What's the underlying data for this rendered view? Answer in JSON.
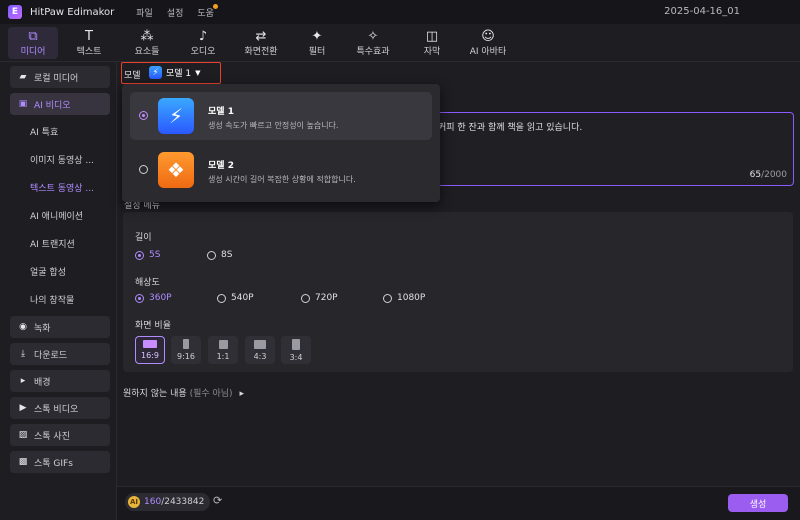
{
  "titlebar": {
    "app_name": "HitPaw Edimakor",
    "menus": [
      "파일",
      "설정",
      "도움"
    ],
    "project_name": "2025-04-16_01"
  },
  "tooltabs": [
    {
      "label": "미디어",
      "icon": "media-icon",
      "active": true
    },
    {
      "label": "텍스트",
      "icon": "text-icon"
    },
    {
      "label": "요소들",
      "icon": "elements-icon"
    },
    {
      "label": "오디오",
      "icon": "audio-icon"
    },
    {
      "label": "화면전환",
      "icon": "transition-icon"
    },
    {
      "label": "필터",
      "icon": "filter-icon"
    },
    {
      "label": "특수효과",
      "icon": "effects-icon"
    },
    {
      "label": "자막",
      "icon": "subtitle-icon"
    },
    {
      "label": "AI 아바타",
      "icon": "avatar-icon"
    }
  ],
  "sidebar": {
    "items": [
      {
        "label": "로컬 미디어"
      },
      {
        "label": "AI 비디오"
      },
      {
        "label": "AI 특효"
      },
      {
        "label": "이미지 동영상 ..."
      },
      {
        "label": "텍스트 동영상 ..."
      },
      {
        "label": "AI 애니메이션"
      },
      {
        "label": "AI 트랜지션"
      },
      {
        "label": "얼굴 합성"
      },
      {
        "label": "나의 창작물"
      },
      {
        "label": "녹화"
      },
      {
        "label": "다운로드"
      },
      {
        "label": "배경"
      },
      {
        "label": "스톡 비디오"
      },
      {
        "label": "스톡 사진"
      },
      {
        "label": "스톡 GIFs"
      }
    ]
  },
  "model_select": {
    "label": "모델",
    "value": "모델 1"
  },
  "model_dropdown": {
    "options": [
      {
        "name": "모델 1",
        "desc": "생성 속도가 빠르고 안정성이 높습니다.",
        "selected": true,
        "color": "#2f7bff"
      },
      {
        "name": "모델 2",
        "desc": "생성 시간이 길어 복잡한 상황에 적합합니다.",
        "selected": false,
        "color": "#f07a1a"
      }
    ]
  },
  "prompt": {
    "text": "커피 한 잔과 함께 책을 읽고 있습니다.",
    "count": "65",
    "max": "/2000"
  },
  "settings": {
    "title": "설정 메뉴",
    "length_label": "길이",
    "length_options": [
      "5S",
      "8S"
    ],
    "length_selected": "5S",
    "resolution_label": "해상도",
    "resolution_options": [
      "360P",
      "540P",
      "720P",
      "1080P"
    ],
    "resolution_selected": "360P",
    "ratio_label": "화면 비율",
    "ratio_options": [
      "16:9",
      "9:16",
      "1:1",
      "4:3",
      "3:4"
    ],
    "ratio_selected": "16:9"
  },
  "negative_prompt": {
    "label": "원하지 않는 내용",
    "hint": "(필수 아님)"
  },
  "bottombar": {
    "credits_used": "160",
    "credits_total": "/2433842",
    "generate_label": "생성"
  },
  "colors": {
    "accent": "#b18cff",
    "highlight_border": "#e8412f",
    "generate_button": "#9b5cf0"
  }
}
